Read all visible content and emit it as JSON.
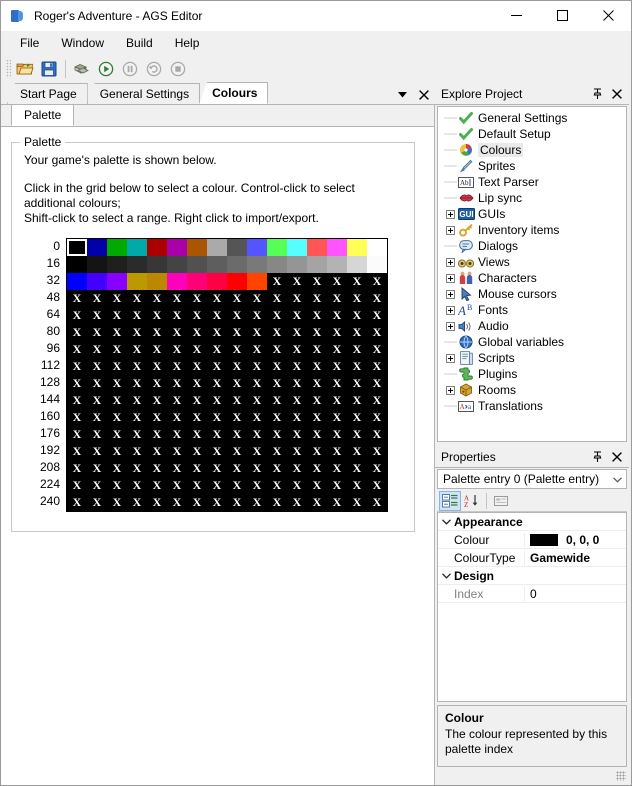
{
  "window": {
    "title": "Roger's Adventure - AGS Editor",
    "icon": "ags-logo-icon",
    "controls": [
      {
        "name": "minimize-button",
        "glyph": "minimize"
      },
      {
        "name": "maximize-button",
        "glyph": "maximize"
      },
      {
        "name": "close-button",
        "glyph": "close"
      }
    ]
  },
  "menubar": {
    "items": [
      "File",
      "Window",
      "Build",
      "Help"
    ]
  },
  "toolbar": {
    "buttons": [
      {
        "name": "open-project-button",
        "icon": "open-folder-icon",
        "enabled": true
      },
      {
        "name": "save-button",
        "icon": "floppy-disk-icon",
        "enabled": true
      },
      {
        "name": "build-button",
        "icon": "build-boxes-icon",
        "enabled": true
      },
      {
        "name": "run-button",
        "icon": "play-icon",
        "enabled": true
      },
      {
        "name": "pause-button",
        "icon": "pause-icon",
        "enabled": false
      },
      {
        "name": "restart-button",
        "icon": "restart-icon",
        "enabled": false
      },
      {
        "name": "stop-button",
        "icon": "stop-icon",
        "enabled": false
      }
    ]
  },
  "document_tabs": {
    "tabs": [
      {
        "label": "Start Page",
        "active": false
      },
      {
        "label": "General Settings",
        "active": false
      },
      {
        "label": "Colours",
        "active": true
      }
    ],
    "dropdown_icon": "chevron-down-icon",
    "close_icon": "close-icon"
  },
  "editor": {
    "subtabs": [
      {
        "label": "Palette",
        "active": true
      }
    ],
    "group_title": "Palette",
    "line1": "Your game's palette is shown below.",
    "line2": "Click in the grid below to select a colour. Control-click to select additional colours;",
    "line3": "Shift-click to select a range.  Right click to import/export."
  },
  "palette": {
    "row_labels": [
      "0",
      "16",
      "32",
      "48",
      "64",
      "80",
      "96",
      "112",
      "128",
      "144",
      "160",
      "176",
      "192",
      "208",
      "224",
      "240"
    ],
    "locked_glyph": "X",
    "selected_index": 0,
    "rows": [
      [
        "#000000",
        "#0000aa",
        "#00aa00",
        "#00aaaa",
        "#aa0000",
        "#aa00aa",
        "#aa5500",
        "#aaaaaa",
        "#555555",
        "#5555ff",
        "#55ff55",
        "#55ffff",
        "#ff5555",
        "#ff55ff",
        "#ffff55",
        "#ffffff"
      ],
      [
        "#000000",
        "#141414",
        "#1f1f1f",
        "#2b2b2b",
        "#373737",
        "#444444",
        "#515151",
        "#5e5e5e",
        "#6b6b6b",
        "#797979",
        "#878787",
        "#959595",
        "#a4a4a4",
        "#b3b3b3",
        "#d6d6d6",
        "#fbfbfb"
      ],
      [
        "#0000ff",
        "#4400ff",
        "#8800ff",
        "#bb9900",
        "#bb8800",
        "#ff00bb",
        "#ff0077",
        "#ff0044",
        "#ff0000",
        "#ff4400",
        "X",
        "X",
        "X",
        "X",
        "X",
        "X"
      ],
      [
        "X",
        "X",
        "X",
        "X",
        "X",
        "X",
        "X",
        "X",
        "X",
        "X",
        "X",
        "X",
        "X",
        "X",
        "X",
        "X"
      ],
      [
        "X",
        "X",
        "X",
        "X",
        "X",
        "X",
        "X",
        "X",
        "X",
        "X",
        "X",
        "X",
        "X",
        "X",
        "X",
        "X"
      ],
      [
        "X",
        "X",
        "X",
        "X",
        "X",
        "X",
        "X",
        "X",
        "X",
        "X",
        "X",
        "X",
        "X",
        "X",
        "X",
        "X"
      ],
      [
        "X",
        "X",
        "X",
        "X",
        "X",
        "X",
        "X",
        "X",
        "X",
        "X",
        "X",
        "X",
        "X",
        "X",
        "X",
        "X"
      ],
      [
        "X",
        "X",
        "X",
        "X",
        "X",
        "X",
        "X",
        "X",
        "X",
        "X",
        "X",
        "X",
        "X",
        "X",
        "X",
        "X"
      ],
      [
        "X",
        "X",
        "X",
        "X",
        "X",
        "X",
        "X",
        "X",
        "X",
        "X",
        "X",
        "X",
        "X",
        "X",
        "X",
        "X"
      ],
      [
        "X",
        "X",
        "X",
        "X",
        "X",
        "X",
        "X",
        "X",
        "X",
        "X",
        "X",
        "X",
        "X",
        "X",
        "X",
        "X"
      ],
      [
        "X",
        "X",
        "X",
        "X",
        "X",
        "X",
        "X",
        "X",
        "X",
        "X",
        "X",
        "X",
        "X",
        "X",
        "X",
        "X"
      ],
      [
        "X",
        "X",
        "X",
        "X",
        "X",
        "X",
        "X",
        "X",
        "X",
        "X",
        "X",
        "X",
        "X",
        "X",
        "X",
        "X"
      ],
      [
        "X",
        "X",
        "X",
        "X",
        "X",
        "X",
        "X",
        "X",
        "X",
        "X",
        "X",
        "X",
        "X",
        "X",
        "X",
        "X"
      ],
      [
        "X",
        "X",
        "X",
        "X",
        "X",
        "X",
        "X",
        "X",
        "X",
        "X",
        "X",
        "X",
        "X",
        "X",
        "X",
        "X"
      ],
      [
        "X",
        "X",
        "X",
        "X",
        "X",
        "X",
        "X",
        "X",
        "X",
        "X",
        "X",
        "X",
        "X",
        "X",
        "X",
        "X"
      ],
      [
        "X",
        "X",
        "X",
        "X",
        "X",
        "X",
        "X",
        "X",
        "X",
        "X",
        "X",
        "X",
        "X",
        "X",
        "X",
        "X"
      ]
    ]
  },
  "explore_project": {
    "title": "Explore Project",
    "pin_icon": "pin-icon",
    "close_icon": "close-icon",
    "items": [
      {
        "label": "General Settings",
        "icon": "green-check-icon",
        "expander": false,
        "selected": false
      },
      {
        "label": "Default Setup",
        "icon": "green-check-icon",
        "expander": false,
        "selected": false
      },
      {
        "label": "Colours",
        "icon": "colour-wheel-icon",
        "expander": false,
        "selected": true
      },
      {
        "label": "Sprites",
        "icon": "brush-icon",
        "expander": false,
        "selected": false
      },
      {
        "label": "Text Parser",
        "icon": "abc-box-icon",
        "expander": false,
        "selected": false
      },
      {
        "label": "Lip sync",
        "icon": "lips-icon",
        "expander": false,
        "selected": false
      },
      {
        "label": "GUIs",
        "icon": "gui-badge-icon",
        "expander": true,
        "selected": false
      },
      {
        "label": "Inventory items",
        "icon": "key-icon",
        "expander": true,
        "selected": false
      },
      {
        "label": "Dialogs",
        "icon": "speech-bubble-icon",
        "expander": false,
        "selected": false
      },
      {
        "label": "Views",
        "icon": "binoculars-icon",
        "expander": true,
        "selected": false
      },
      {
        "label": "Characters",
        "icon": "people-icon",
        "expander": true,
        "selected": false
      },
      {
        "label": "Mouse cursors",
        "icon": "cursor-arrow-icon",
        "expander": true,
        "selected": false
      },
      {
        "label": "Fonts",
        "icon": "font-ab-icon",
        "expander": true,
        "selected": false
      },
      {
        "label": "Audio",
        "icon": "speaker-icon",
        "expander": true,
        "selected": false
      },
      {
        "label": "Global variables",
        "icon": "globe-icon",
        "expander": false,
        "selected": false
      },
      {
        "label": "Scripts",
        "icon": "script-page-icon",
        "expander": true,
        "selected": false
      },
      {
        "label": "Plugins",
        "icon": "puzzle-piece-icon",
        "expander": false,
        "selected": false
      },
      {
        "label": "Rooms",
        "icon": "rooms-cube-icon",
        "expander": true,
        "selected": false
      },
      {
        "label": "Translations",
        "icon": "translate-icon",
        "expander": false,
        "selected": false
      }
    ]
  },
  "properties": {
    "title": "Properties",
    "pin_icon": "pin-icon",
    "close_icon": "close-icon",
    "selected_object": "Palette entry 0 (Palette entry)",
    "dropdown_icon": "chevron-down-icon",
    "toolbar": [
      {
        "name": "categorized-button",
        "icon": "categorized-icon",
        "active": true
      },
      {
        "name": "alphabetical-button",
        "icon": "sort-az-icon",
        "active": false
      },
      {
        "name": "property-pages-button",
        "icon": "property-pages-icon",
        "active": false
      }
    ],
    "groups": [
      {
        "name": "Appearance",
        "expanded": true,
        "rows": [
          {
            "name": "Colour",
            "value": "0, 0, 0",
            "swatch": "#000000",
            "bold": true,
            "dim": false
          },
          {
            "name": "ColourType",
            "value": "Gamewide",
            "swatch": null,
            "bold": true,
            "dim": false
          }
        ]
      },
      {
        "name": "Design",
        "expanded": true,
        "rows": [
          {
            "name": "Index",
            "value": "0",
            "swatch": null,
            "bold": false,
            "dim": true
          }
        ]
      }
    ],
    "description": {
      "title": "Colour",
      "text": "The colour represented by this palette index"
    }
  }
}
